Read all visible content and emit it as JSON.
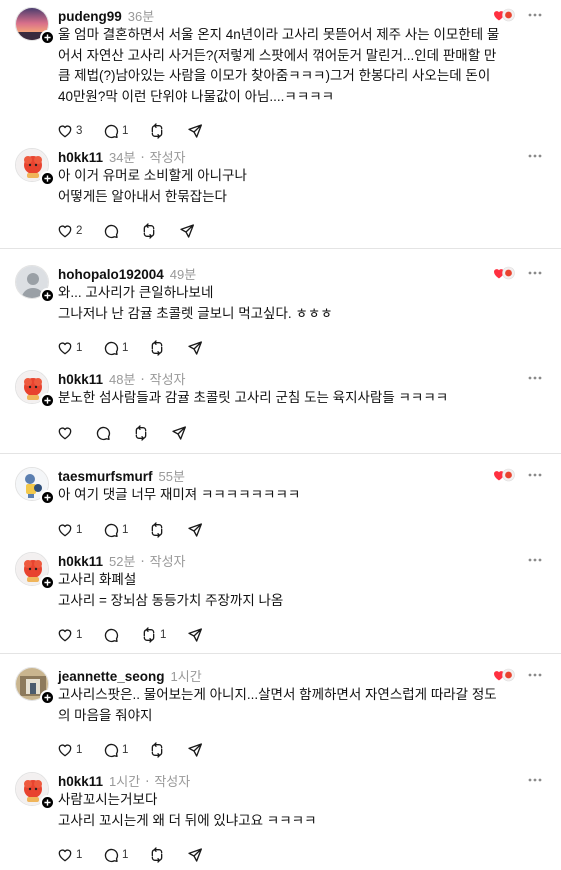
{
  "threads": [
    {
      "main": {
        "username": "pudeng99",
        "time": "36분",
        "lines": [
          "울 엄마 결혼하면서 서울 온지 4n년이라 고사리 못뜯어서 제주 사는 이모한테 물",
          "어서 자연산 고사리 사거든?(저렇게 스팟에서 꺾어둔거 말린거...인데 판매할 만",
          "큼 제법(?)남아있는 사람을 이모가 찾아줌ㅋㅋㅋ)그거 한봉다리 사오는데 돈이",
          "40만원?막 이런 단위야 나물값이 아님....ㅋㅋㅋㅋ"
        ],
        "likes": "3",
        "replies": "1",
        "reposts": "",
        "liked_by_author": true
      },
      "reply": {
        "username": "h0kk11",
        "time": "34분",
        "tag": "작성자",
        "lines": [
          "아 이거 유머로 소비할게 아니구나",
          "어떻게든 알아내서 한묶잡는다"
        ],
        "likes": "2",
        "replies": "",
        "reposts": ""
      }
    },
    {
      "main": {
        "username": "hohopalo192004",
        "time": "49분",
        "lines": [
          "와... 고사리가 큰일하나보네",
          "그나저나 난 감귤 초콜렛 글보니 먹고싶다. ㅎㅎㅎ"
        ],
        "likes": "1",
        "replies": "1",
        "reposts": "",
        "liked_by_author": true
      },
      "reply": {
        "username": "h0kk11",
        "time": "48분",
        "tag": "작성자",
        "lines": [
          "분노한 섬사람들과 감귤 초콜릿 고사리 군침 도는 육지사람들 ㅋㅋㅋㅋ"
        ],
        "likes": "",
        "replies": "",
        "reposts": ""
      }
    },
    {
      "main": {
        "username": "taesmurfsmurf",
        "time": "55분",
        "lines": [
          "아 여기 댓글 너무 재미져 ㅋㅋㅋㅋㅋㅋㅋㅋ"
        ],
        "likes": "1",
        "replies": "1",
        "reposts": "",
        "liked_by_author": true
      },
      "reply": {
        "username": "h0kk11",
        "time": "52분",
        "tag": "작성자",
        "lines": [
          "고사리 화폐설",
          "고사리 = 장뇌삼 동등가치 주장까지 나옴"
        ],
        "likes": "1",
        "replies": "",
        "reposts": "1"
      }
    },
    {
      "main": {
        "username": "jeannette_seong",
        "time": "1시간",
        "lines": [
          "고사리스팟은.. 물어보는게 아니지...살면서 함께하면서 자연스럽게 따라갈 정도",
          "의 마음을 줘야지"
        ],
        "likes": "1",
        "replies": "1",
        "reposts": "",
        "liked_by_author": true
      },
      "reply": {
        "username": "h0kk11",
        "time": "1시간",
        "tag": "작성자",
        "lines": [
          "사람꼬시는거보다",
          "고사리 꼬시는게 왜 더 뒤에 있냐고요 ㅋㅋㅋㅋ"
        ],
        "likes": "1",
        "replies": "1",
        "reposts": ""
      }
    }
  ],
  "icons": {
    "like": "heart-icon",
    "reply": "reply-bubble-icon",
    "repost": "repost-icon",
    "share": "send-icon",
    "more": "more-dots-icon",
    "follow": "follow-plus-icon",
    "liked_by_author": "author-liked-heart-icon"
  },
  "colors": {
    "heart_red": "#ff3040",
    "meta_gray": "#999999",
    "text": "#101010",
    "divider": "#e4e4e4"
  }
}
